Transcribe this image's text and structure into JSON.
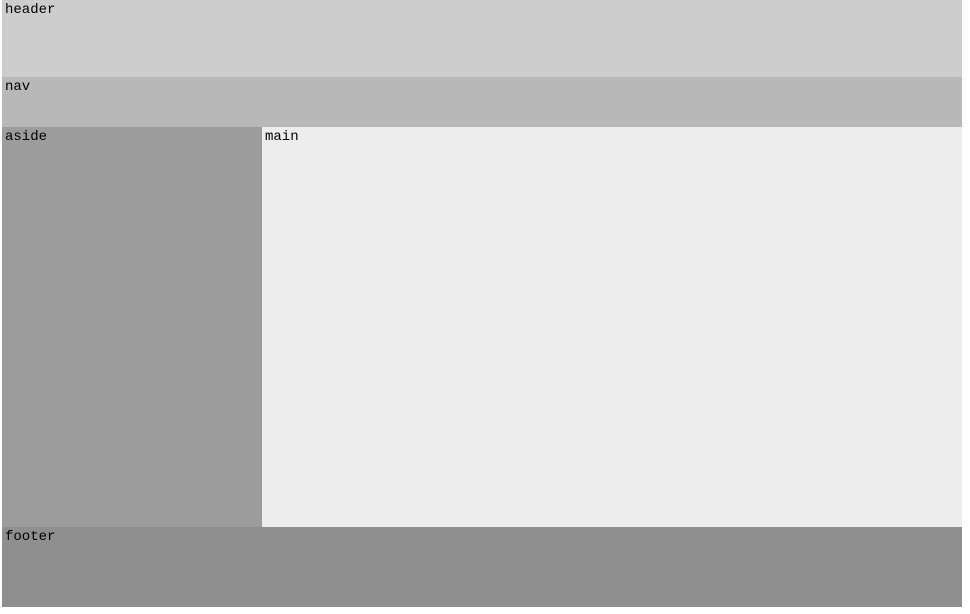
{
  "layout": {
    "header_label": "header",
    "nav_label": "nav",
    "aside_label": "aside",
    "main_label": "main",
    "footer_label": "footer"
  }
}
